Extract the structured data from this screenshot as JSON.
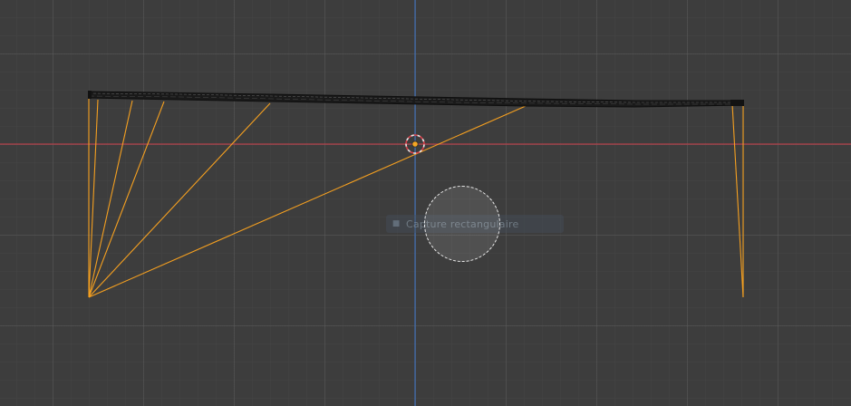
{
  "viewport": {
    "background": "#3d3d3d",
    "x_axis_color": "#b3404a",
    "y_axis_color": "#3f6fb6",
    "selection_color": "#f5a020",
    "mesh_color": "#161616",
    "origin_color": "#f5a623"
  },
  "overlay": {
    "tool_label": "Capture rectangulaire",
    "tool_icon": "select-box-icon"
  }
}
